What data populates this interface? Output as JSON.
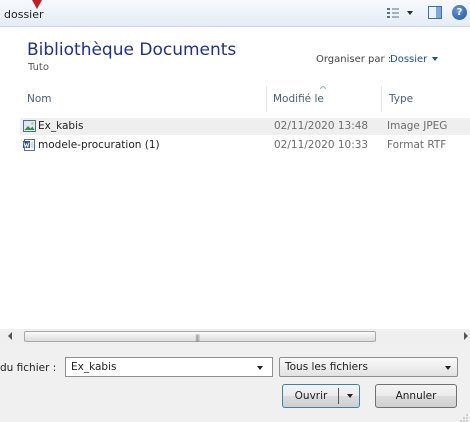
{
  "toolbar": {
    "breadcrumb": "dossier",
    "view_icon": "view-options-icon",
    "pane_icon": "preview-pane-icon",
    "help_icon": "help-icon",
    "help_glyph": "?"
  },
  "library": {
    "title": "Bibliothèque Documents",
    "subtitle": "Tuto",
    "arrange_label": "Organiser par :",
    "arrange_value": "Dossier"
  },
  "columns": {
    "name": "Nom",
    "modified": "Modifié le",
    "type": "Type"
  },
  "files": [
    {
      "name": "Ex_kabis",
      "modified": "02/11/2020 13:48",
      "type": "Image JPEG",
      "icon": "image-file-icon"
    },
    {
      "name": "modele-procuration (1)",
      "modified": "02/11/2020 10:33",
      "type": "Format RTF",
      "icon": "word-document-icon"
    }
  ],
  "footer": {
    "filename_label": "du fichier :",
    "filename_value": "Ex_kabis",
    "filetype_value": "Tous les fichiers",
    "open_button": "Ouvrir",
    "cancel_button": "Annuler"
  },
  "colors": {
    "title": "#1e3287",
    "link": "#1c4fa1",
    "arrow": "#c41f1f",
    "selected_row": "#efefef"
  }
}
